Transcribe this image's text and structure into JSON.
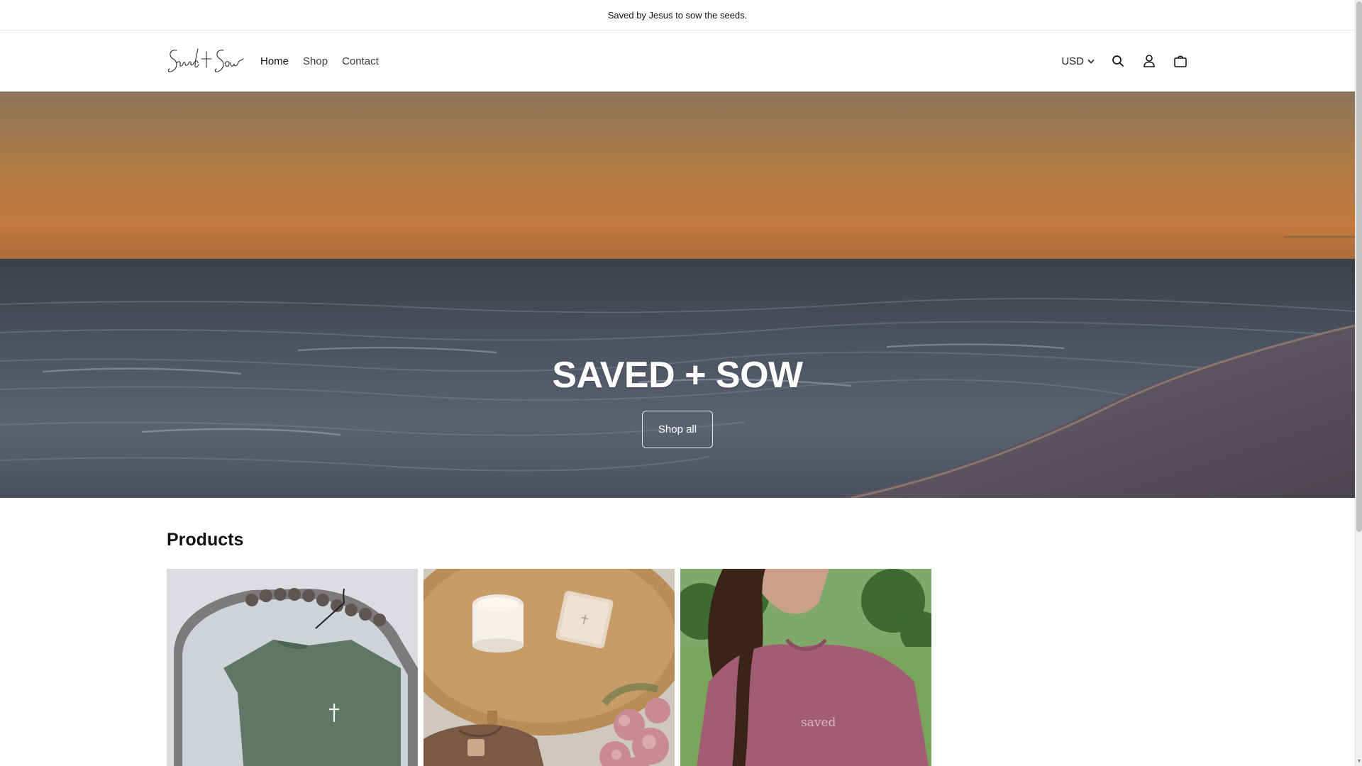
{
  "announcement": {
    "text": "Saved by Jesus to sow the seeds."
  },
  "header": {
    "logo_text": "Saved + Sow",
    "nav": [
      {
        "label": "Home",
        "active": true
      },
      {
        "label": "Shop",
        "active": false
      },
      {
        "label": "Contact",
        "active": false
      }
    ],
    "currency": "USD",
    "icons": [
      "search-icon",
      "account-icon",
      "cart-icon"
    ]
  },
  "hero": {
    "title": "SAVED + SOW",
    "button_label": "Shop all"
  },
  "products": {
    "title": "Products",
    "items": [
      {
        "image": "sage-green-cross-tee-on-mirror"
      },
      {
        "image": "candle-tray-and-brown-tee"
      },
      {
        "image": "mauve-saved-tee-outdoors",
        "print_text": "saved"
      }
    ]
  }
}
